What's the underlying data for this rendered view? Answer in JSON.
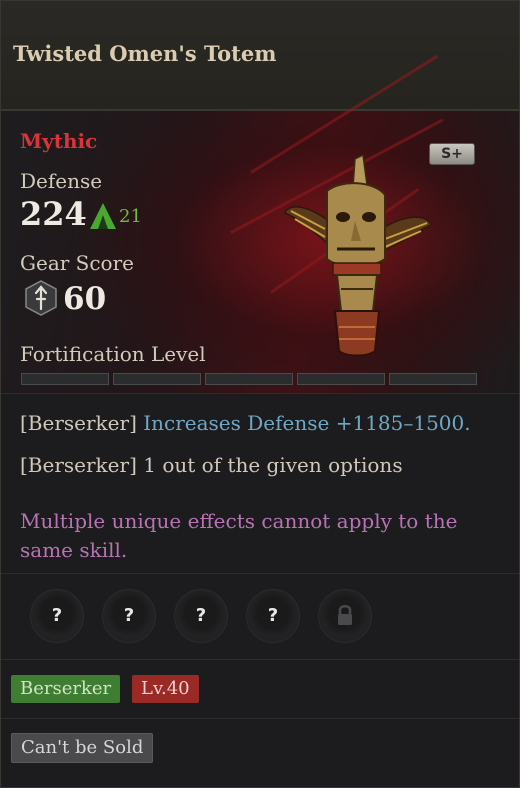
{
  "item": {
    "name": "Twisted Omen's Totem",
    "rarity": "Mythic",
    "tier_badge": "S+",
    "icon": "totem-icon"
  },
  "stats": {
    "defense_label": "Defense",
    "defense_value": "224",
    "defense_delta": "21",
    "gear_score_label": "Gear Score",
    "gear_score_value": "60",
    "fortification_label": "Fortification Level",
    "fortification_segments": 5,
    "fortification_filled": 0
  },
  "effects": [
    {
      "class": "[Berserker]",
      "text": "Increases Defense +1185–1500."
    },
    {
      "class": "[Berserker]",
      "text": "1 out of the given options"
    }
  ],
  "unique_note": "Multiple unique effects cannot apply to the same skill.",
  "sockets": [
    {
      "symbol": "?",
      "locked": false
    },
    {
      "symbol": "?",
      "locked": false
    },
    {
      "symbol": "?",
      "locked": false
    },
    {
      "symbol": "?",
      "locked": false
    },
    {
      "symbol": "",
      "locked": true
    }
  ],
  "requirements": {
    "class": "Berserker",
    "level": "Lv.40"
  },
  "trade": {
    "sold_label": "Can't be Sold"
  },
  "colors": {
    "mythic": "#d8343a",
    "effect_blue": "#6ea8c4",
    "unique_purple": "#b873b5",
    "class_tag": "#3f7d32",
    "level_tag": "#9a2a26",
    "delta_green": "#6ebd3c"
  }
}
